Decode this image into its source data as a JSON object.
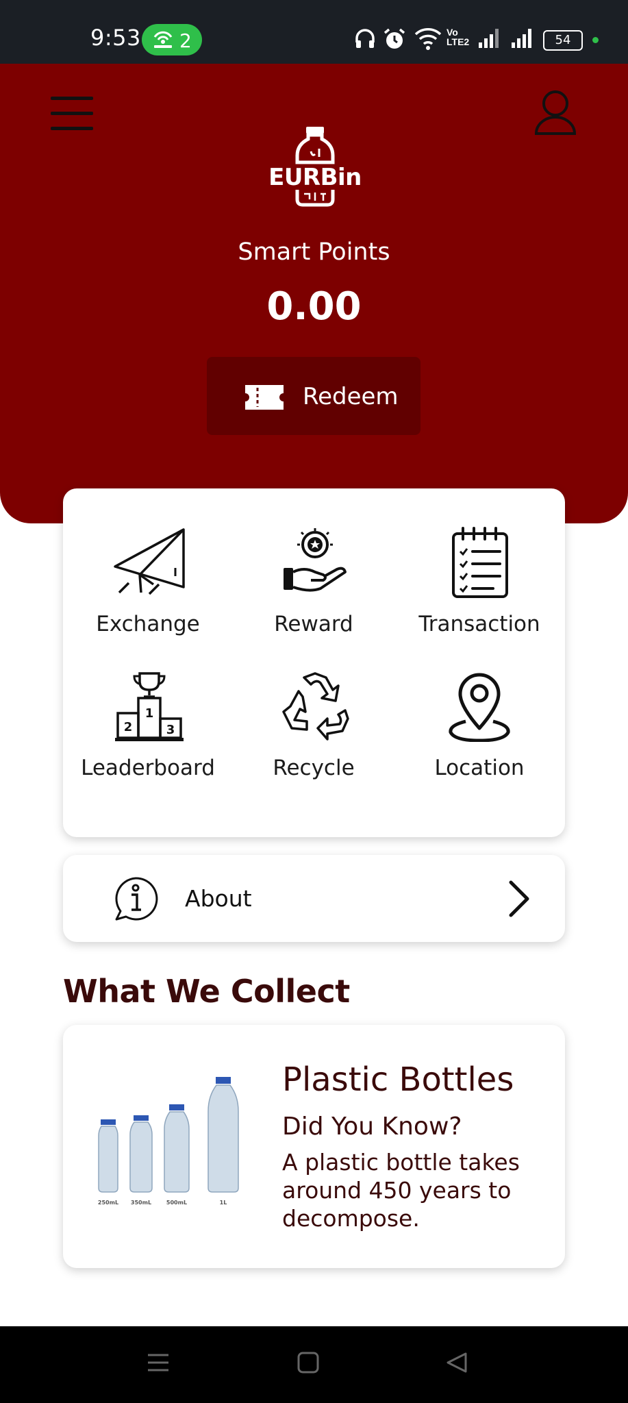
{
  "status_bar": {
    "time": "9:53",
    "hotspot_count": "2",
    "battery": "54"
  },
  "header": {
    "app_name": "EURBin",
    "points_label": "Smart Points",
    "points_value": "0.00",
    "redeem_label": "Redeem",
    "background_color": "#7d0000"
  },
  "menu": {
    "items": [
      {
        "label": "Exchange",
        "icon": "paper-plane-icon"
      },
      {
        "label": "Reward",
        "icon": "reward-hand-icon"
      },
      {
        "label": "Transaction",
        "icon": "checklist-icon"
      },
      {
        "label": "Leaderboard",
        "icon": "podium-icon"
      },
      {
        "label": "Recycle",
        "icon": "recycle-icon"
      },
      {
        "label": "Location",
        "icon": "location-pin-icon"
      }
    ]
  },
  "about": {
    "label": "About"
  },
  "collect": {
    "section_title": "What We Collect",
    "card_title": "Plastic Bottles",
    "card_subtitle": "Did You Know?",
    "card_text": "A plastic bottle takes around 450 years to decompose.",
    "bottle_sizes": [
      "250mL",
      "350mL",
      "500mL",
      "1L"
    ]
  }
}
